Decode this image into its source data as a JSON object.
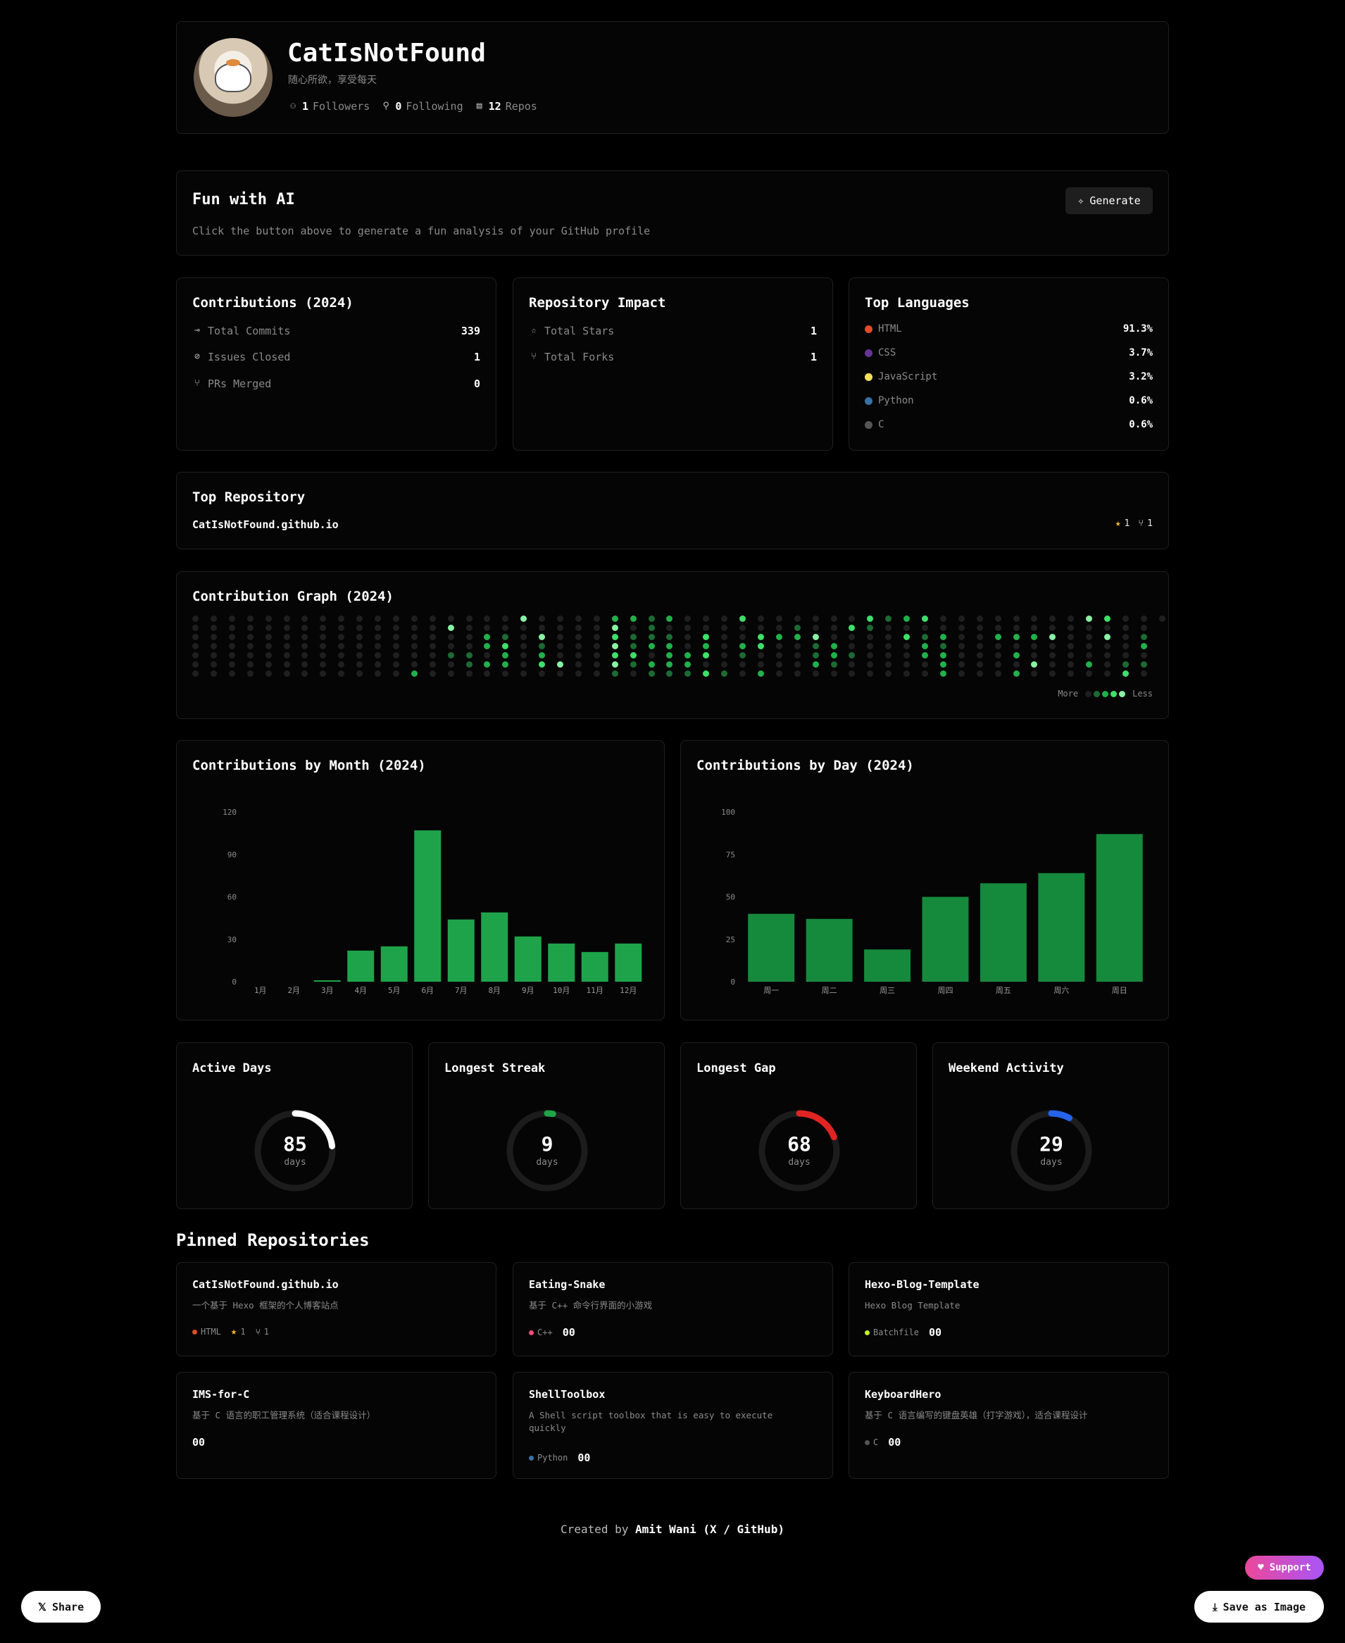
{
  "profile": {
    "name": "CatIsNotFound",
    "bio": "随心所欲，享受每天",
    "followers": "1",
    "followers_label": "Followers",
    "following": "0",
    "following_label": "Following",
    "repos": "12",
    "repos_label": "Repos"
  },
  "ai": {
    "title": "Fun with AI",
    "hint": "Click the button above to generate a fun analysis of your GitHub profile",
    "button": "Generate"
  },
  "contributions": {
    "title": "Contributions (2024)",
    "rows": [
      {
        "icon": "commit-icon",
        "glyph": "⊸",
        "label": "Total Commits",
        "value": "339"
      },
      {
        "icon": "issue-closed-icon",
        "glyph": "⊘",
        "label": "Issues Closed",
        "value": "1"
      },
      {
        "icon": "pr-merged-icon",
        "glyph": "⑂",
        "label": "PRs Merged",
        "value": "0"
      }
    ]
  },
  "impact": {
    "title": "Repository Impact",
    "rows": [
      {
        "icon": "star-icon",
        "glyph": "☆",
        "label": "Total Stars",
        "value": "1"
      },
      {
        "icon": "fork-icon",
        "glyph": "⑂",
        "label": "Total Forks",
        "value": "1"
      }
    ]
  },
  "languages": {
    "title": "Top Languages",
    "items": [
      {
        "name": "HTML",
        "pct": "91.3%",
        "color": "#e34c26"
      },
      {
        "name": "CSS",
        "pct": "3.7%",
        "color": "#663399"
      },
      {
        "name": "JavaScript",
        "pct": "3.2%",
        "color": "#f1e05a"
      },
      {
        "name": "Python",
        "pct": "0.6%",
        "color": "#3572a5"
      },
      {
        "name": "C",
        "pct": "0.6%",
        "color": "#555555"
      }
    ]
  },
  "top_repo": {
    "title": "Top Repository",
    "name": "CatIsNotFound.github.io",
    "stars": "1",
    "forks": "1"
  },
  "graph": {
    "title": "Contribution Graph (2024)",
    "legend_more": "More",
    "legend_less": "Less",
    "levels": [
      "#1b1b1b",
      "#0e4429",
      "#006d32",
      "#26a641",
      "#39d353"
    ],
    "level_colors_used": [
      "#1f1f1f",
      "#1c6b33",
      "#21b04b",
      "#3ee06a",
      "#8af0a4"
    ],
    "weeks": 54
  },
  "chart_data": [
    {
      "type": "bar",
      "title": "Contributions by Month (2024)",
      "categories": [
        "1月",
        "2月",
        "3月",
        "4月",
        "5月",
        "6月",
        "7月",
        "8月",
        "9月",
        "10月",
        "11月",
        "12月"
      ],
      "values": [
        0,
        0,
        1,
        22,
        25,
        107,
        44,
        49,
        32,
        27,
        21,
        27
      ],
      "ylim": [
        0,
        120
      ],
      "yticks": [
        "0",
        "30",
        "60",
        "90",
        "120"
      ],
      "color": "#1fa34a"
    },
    {
      "type": "bar",
      "title": "Contributions by Day (2024)",
      "categories": [
        "周一",
        "周二",
        "周三",
        "周四",
        "周五",
        "周六",
        "周日"
      ],
      "values": [
        40,
        37,
        19,
        50,
        58,
        64,
        87
      ],
      "ylim": [
        0,
        100
      ],
      "yticks": [
        "0",
        "25",
        "50",
        "75",
        "100"
      ],
      "color": "#168a3c"
    }
  ],
  "rings": [
    {
      "title": "Active Days",
      "value": "85",
      "unit": "days",
      "fraction": 0.23,
      "color": "#ffffff"
    },
    {
      "title": "Longest Streak",
      "value": "9",
      "unit": "days",
      "fraction": 0.025,
      "color": "#21a347"
    },
    {
      "title": "Longest Gap",
      "value": "68",
      "unit": "days",
      "fraction": 0.19,
      "color": "#e02424"
    },
    {
      "title": "Weekend Activity",
      "value": "29",
      "unit": "days",
      "fraction": 0.08,
      "color": "#2563eb"
    }
  ],
  "pinned": {
    "title": "Pinned Repositories",
    "repos": [
      {
        "name": "CatIsNotFound.github.io",
        "desc": "一个基于 Hexo 框架的个人博客站点",
        "lang": "HTML",
        "lang_color": "#e34c26",
        "stars": "1",
        "forks": "1",
        "extra": ""
      },
      {
        "name": "Eating-Snake",
        "desc": "基于 C++ 命令行界面的小游戏",
        "lang": "C++",
        "lang_color": "#f34b7d",
        "stars": "",
        "forks": "",
        "extra": "00"
      },
      {
        "name": "Hexo-Blog-Template",
        "desc": "Hexo Blog Template",
        "lang": "Batchfile",
        "lang_color": "#c1f12e",
        "stars": "",
        "forks": "",
        "extra": "00"
      },
      {
        "name": "IMS-for-C",
        "desc": "基于 C 语言的职工管理系统（适合课程设计）",
        "lang": "",
        "lang_color": "",
        "stars": "",
        "forks": "",
        "extra": "00"
      },
      {
        "name": "ShellToolbox",
        "desc": "A Shell script toolbox that is easy to execute quickly",
        "lang": "Python",
        "lang_color": "#3572a5",
        "stars": "",
        "forks": "",
        "extra": "00"
      },
      {
        "name": "KeyboardHero",
        "desc": "基于 C 语言编写的键盘英雄（打字游戏），适合课程设计",
        "lang": "C",
        "lang_color": "#555555",
        "stars": "",
        "forks": "",
        "extra": "00"
      }
    ]
  },
  "footer": {
    "created_by": "Created by",
    "author": "Amit Wani",
    "links": "(X / GitHub)"
  },
  "actions": {
    "support": "Support",
    "share": "Share",
    "save": "Save as Image"
  }
}
